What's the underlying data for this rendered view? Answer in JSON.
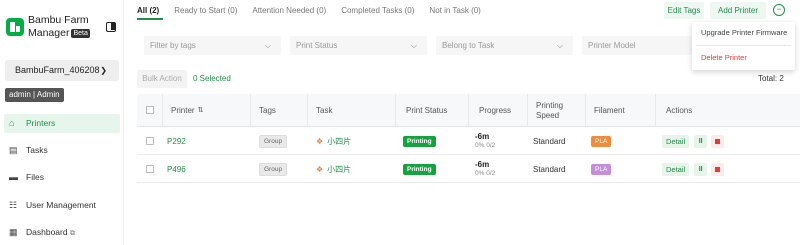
{
  "app": {
    "title": "Bambu Farm Manager",
    "beta": "Beta"
  },
  "device": {
    "name": "BambuFarm_406208"
  },
  "user": {
    "badge": "admin  |  Admin"
  },
  "nav": [
    {
      "label": "Printers"
    },
    {
      "label": "Tasks"
    },
    {
      "label": "Files"
    },
    {
      "label": "User Management"
    },
    {
      "label": "Dashboard"
    }
  ],
  "tabs": [
    {
      "label": "All (2)"
    },
    {
      "label": "Ready to Start (0)"
    },
    {
      "label": "Attention Needed (0)"
    },
    {
      "label": "Completed Tasks (0)"
    },
    {
      "label": "Not in Task (0)"
    }
  ],
  "toolbar": {
    "edit_tags": "Edit Tags",
    "add_printer": "Add Printer"
  },
  "filters": {
    "tags": "Filter by tags",
    "status": "Print Status",
    "task": "Belong to Task",
    "model": "Printer Model"
  },
  "bulk": {
    "label": "Bulk Action",
    "selected": "0 Selected",
    "total": "Total: 2"
  },
  "columns": {
    "printer": "Printer",
    "tags": "Tags",
    "task": "Task",
    "status": "Print Status",
    "progress": "Progress",
    "speed_1": "Printing",
    "speed_2": "Speed",
    "filament": "Filament",
    "actions": "Actions"
  },
  "rows": [
    {
      "printer": "P292",
      "tag": "Group",
      "task": "小四片",
      "status": "Printing",
      "time": "-6m",
      "progress": "0% 0/2",
      "speed": "Standard",
      "filament": "PLA",
      "detail": "Detail"
    },
    {
      "printer": "P496",
      "tag": "Group",
      "task": "小四片",
      "status": "Printing",
      "time": "-6m",
      "progress": "0% 0/2",
      "speed": "Standard",
      "filament": "PLA",
      "detail": "Detail"
    }
  ],
  "dropdown": {
    "upgrade": "Upgrade Printer Firmware",
    "delete": "Delete Printer"
  },
  "colors": {
    "accent": "#1f8f4a",
    "printing": "#15a33f",
    "filament_row1": "#f08c3a",
    "filament_row2": "#c48fd8",
    "danger": "#e23b3b"
  }
}
